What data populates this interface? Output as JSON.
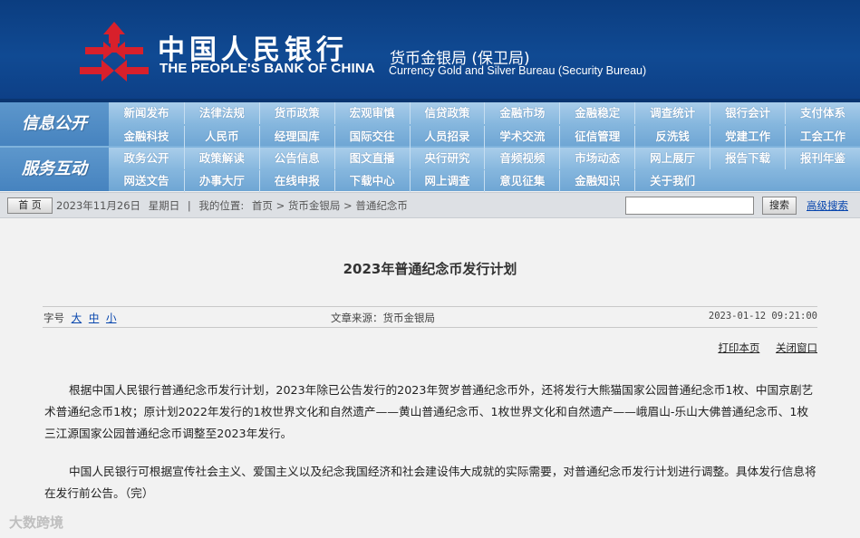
{
  "header": {
    "title_cn": "中国人民银行",
    "title_en": "THE PEOPLE'S BANK OF CHINA",
    "bureau_cn": "货币金银局 (保卫局)",
    "bureau_en": "Currency Gold and Silver Bureau (Security Bureau)",
    "logo_color": "#d8202b"
  },
  "nav": {
    "band1_label": "信息公开",
    "band2_label": "服务互动",
    "rows": [
      [
        "新闻发布",
        "法律法规",
        "货币政策",
        "宏观审慎",
        "信贷政策",
        "金融市场",
        "金融稳定",
        "调查统计",
        "银行会计",
        "支付体系"
      ],
      [
        "金融科技",
        "人民币",
        "经理国库",
        "国际交往",
        "人员招录",
        "学术交流",
        "征信管理",
        "反洗钱",
        "党建工作",
        "工会工作"
      ],
      [
        "政务公开",
        "政策解读",
        "公告信息",
        "图文直播",
        "央行研究",
        "音频视频",
        "市场动态",
        "网上展厅",
        "报告下载",
        "报刊年鉴"
      ],
      [
        "网送文告",
        "办事大厅",
        "在线申报",
        "下载中心",
        "网上调查",
        "意见征集",
        "金融知识",
        "关于我们"
      ]
    ]
  },
  "breadcrumb": {
    "home": "首 页",
    "date": "2023年11月26日",
    "weekday": "星期日",
    "location_label": "我的位置:",
    "path": "首页 > 货币金银局 > 普通纪念币",
    "search_button": "搜索",
    "advanced_search": "高级搜索"
  },
  "article": {
    "title": "2023年普通纪念币发行计划",
    "font_label": "字号",
    "font_large": "大",
    "font_medium": "中",
    "font_small": "小",
    "source": "文章来源：货币金银局",
    "datetime": "2023-01-12  09:21:00",
    "print_link": "打印本页",
    "close_link": "关闭窗口",
    "paragraph1": "根据中国人民银行普通纪念币发行计划，2023年除已公告发行的2023年贺岁普通纪念币外，还将发行大熊猫国家公园普通纪念币1枚、中国京剧艺术普通纪念币1枚；原计划2022年发行的1枚世界文化和自然遗产——黄山普通纪念币、1枚世界文化和自然遗产——峨眉山-乐山大佛普通纪念币、1枚三江源国家公园普通纪念币调整至2023年发行。",
    "paragraph2": "中国人民银行可根据宣传社会主义、爱国主义以及纪念我国经济和社会建设伟大成就的实际需要，对普通纪念币发行计划进行调整。具体发行信息将在发行前公告。（完）"
  },
  "watermark": "大数跨境"
}
